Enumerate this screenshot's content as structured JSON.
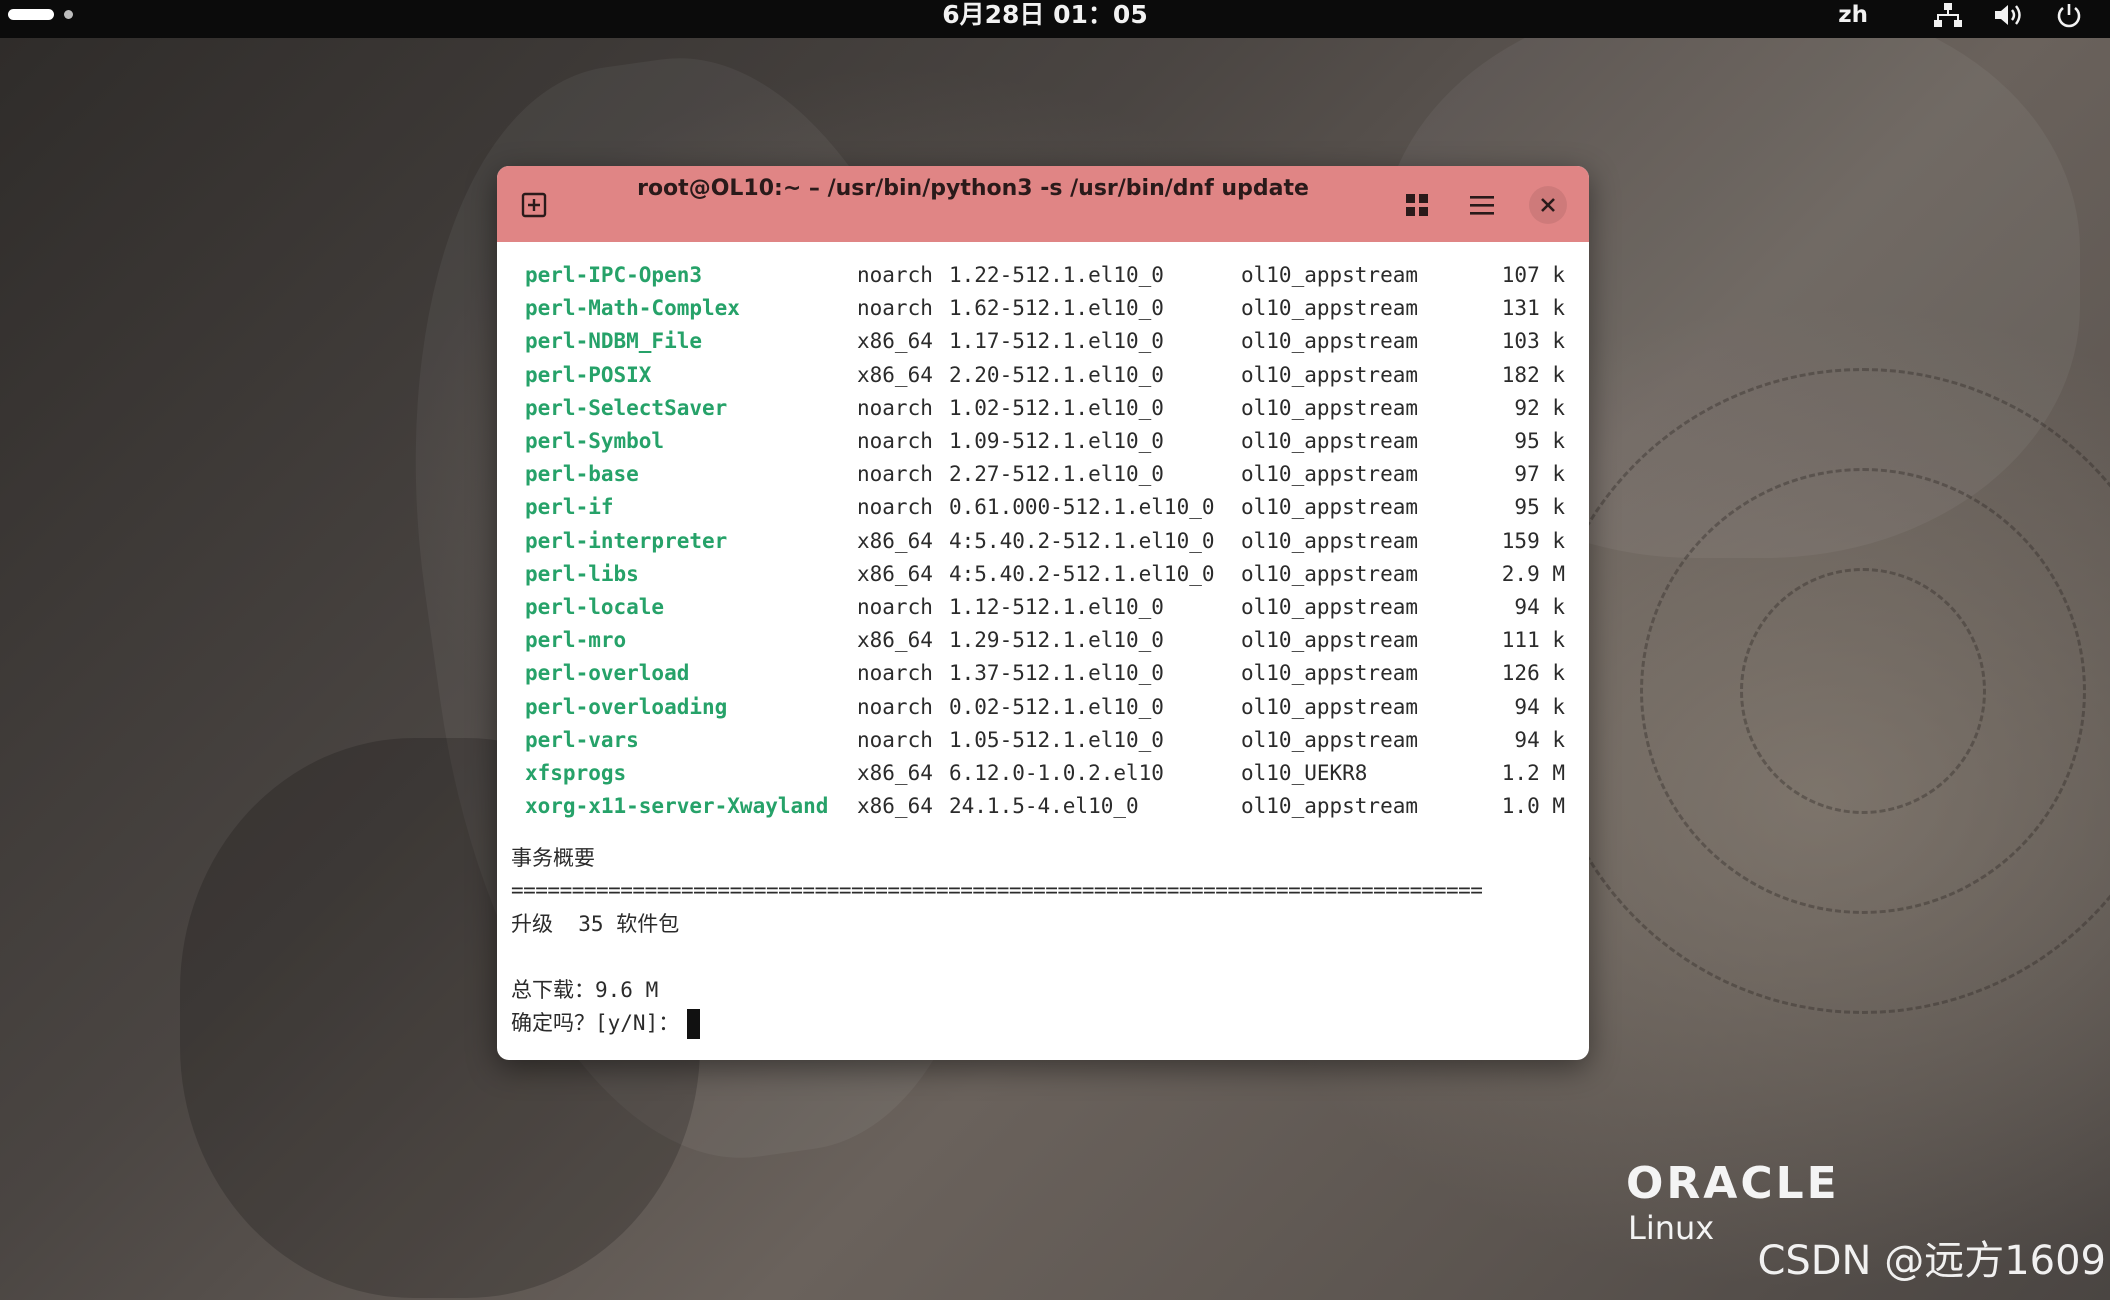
{
  "topbar": {
    "clock": "6月28日 01：05",
    "language": "zh",
    "icons": [
      "activities-indicator",
      "network-icon",
      "volume-icon",
      "power-icon"
    ]
  },
  "terminal": {
    "title": "root@OL10:~ – /usr/bin/python3 -s /usr/bin/dnf update",
    "titlebar_color": "#e08585",
    "package_name_color": "#26a269",
    "packages": [
      {
        "name": "perl-IPC-Open3",
        "arch": "noarch",
        "version": "1.22-512.1.el10_0",
        "repo": "ol10_appstream",
        "size": "107 k"
      },
      {
        "name": "perl-Math-Complex",
        "arch": "noarch",
        "version": "1.62-512.1.el10_0",
        "repo": "ol10_appstream",
        "size": "131 k"
      },
      {
        "name": "perl-NDBM_File",
        "arch": "x86_64",
        "version": "1.17-512.1.el10_0",
        "repo": "ol10_appstream",
        "size": "103 k"
      },
      {
        "name": "perl-POSIX",
        "arch": "x86_64",
        "version": "2.20-512.1.el10_0",
        "repo": "ol10_appstream",
        "size": "182 k"
      },
      {
        "name": "perl-SelectSaver",
        "arch": "noarch",
        "version": "1.02-512.1.el10_0",
        "repo": "ol10_appstream",
        "size": "92 k"
      },
      {
        "name": "perl-Symbol",
        "arch": "noarch",
        "version": "1.09-512.1.el10_0",
        "repo": "ol10_appstream",
        "size": "95 k"
      },
      {
        "name": "perl-base",
        "arch": "noarch",
        "version": "2.27-512.1.el10_0",
        "repo": "ol10_appstream",
        "size": "97 k"
      },
      {
        "name": "perl-if",
        "arch": "noarch",
        "version": "0.61.000-512.1.el10_0",
        "repo": "ol10_appstream",
        "size": "95 k"
      },
      {
        "name": "perl-interpreter",
        "arch": "x86_64",
        "version": "4:5.40.2-512.1.el10_0",
        "repo": "ol10_appstream",
        "size": "159 k"
      },
      {
        "name": "perl-libs",
        "arch": "x86_64",
        "version": "4:5.40.2-512.1.el10_0",
        "repo": "ol10_appstream",
        "size": "2.9 M"
      },
      {
        "name": "perl-locale",
        "arch": "noarch",
        "version": "1.12-512.1.el10_0",
        "repo": "ol10_appstream",
        "size": "94 k"
      },
      {
        "name": "perl-mro",
        "arch": "x86_64",
        "version": "1.29-512.1.el10_0",
        "repo": "ol10_appstream",
        "size": "111 k"
      },
      {
        "name": "perl-overload",
        "arch": "noarch",
        "version": "1.37-512.1.el10_0",
        "repo": "ol10_appstream",
        "size": "126 k"
      },
      {
        "name": "perl-overloading",
        "arch": "noarch",
        "version": "0.02-512.1.el10_0",
        "repo": "ol10_appstream",
        "size": "94 k"
      },
      {
        "name": "perl-vars",
        "arch": "noarch",
        "version": "1.05-512.1.el10_0",
        "repo": "ol10_appstream",
        "size": "94 k"
      },
      {
        "name": "xfsprogs",
        "arch": "x86_64",
        "version": "6.12.0-1.0.2.el10",
        "repo": "ol10_UEKR8",
        "size": "1.2 M"
      },
      {
        "name": "xorg-x11-server-Xwayland",
        "arch": "x86_64",
        "version": "24.1.5-4.el10_0",
        "repo": "ol10_appstream",
        "size": "1.0 M"
      }
    ],
    "summary_heading": "事务概要",
    "separator": "================================================================================",
    "upgrade_line": "升级  35 软件包",
    "total_download": "总下载：9.6 M",
    "prompt": "确定吗？[y/N]："
  },
  "desktop": {
    "logo_word": "ORACLE",
    "logo_sub": "Linux",
    "watermark": "CSDN @远方1609"
  }
}
